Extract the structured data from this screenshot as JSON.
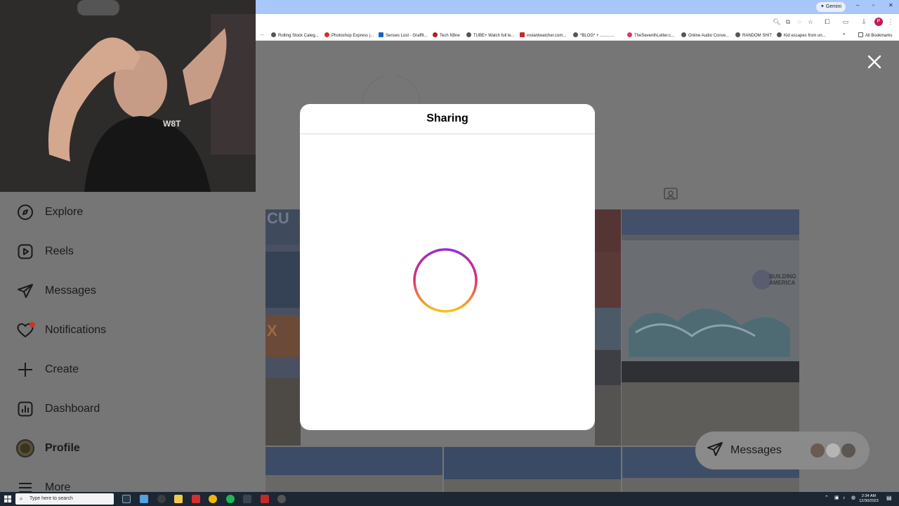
{
  "browser": {
    "gemini_label": "✦ Gemini",
    "profile_initial": "P",
    "bookmarks": [
      "Rolling Stock Categ...",
      "Photoshop Express |...",
      "Senses Lost - Graffit...",
      "Tech N9ne",
      "TUBE+ Watch full le...",
      "instantwatcher.com...",
      "*BLOG* + ............",
      "TheSeventhLetter.c...",
      "Online Audio Conve...",
      "RANDOM SHIT",
      "Kid escapes from un..."
    ],
    "all_bookmarks": "All Bookmarks"
  },
  "sidebar": {
    "items": [
      {
        "label": "Explore",
        "icon": "compass-icon"
      },
      {
        "label": "Reels",
        "icon": "reels-icon"
      },
      {
        "label": "Messages",
        "icon": "paper-plane-icon"
      },
      {
        "label": "Notifications",
        "icon": "heart-icon"
      },
      {
        "label": "Create",
        "icon": "plus-icon"
      },
      {
        "label": "Dashboard",
        "icon": "chart-icon"
      },
      {
        "label": "Profile",
        "icon": "avatar-icon"
      },
      {
        "label": "More",
        "icon": "hamburger-icon"
      }
    ]
  },
  "modal": {
    "title": "Sharing"
  },
  "messages_pill": {
    "label": "Messages"
  },
  "taskbar": {
    "search_placeholder": "Type here to search",
    "time": "2:34 AM",
    "date": "12/30/2023"
  },
  "colors": {
    "overlay": "#767676",
    "spinner_start": "#9b2bd1",
    "spinner_mid": "#e0306c",
    "spinner_end": "#f5c518"
  }
}
